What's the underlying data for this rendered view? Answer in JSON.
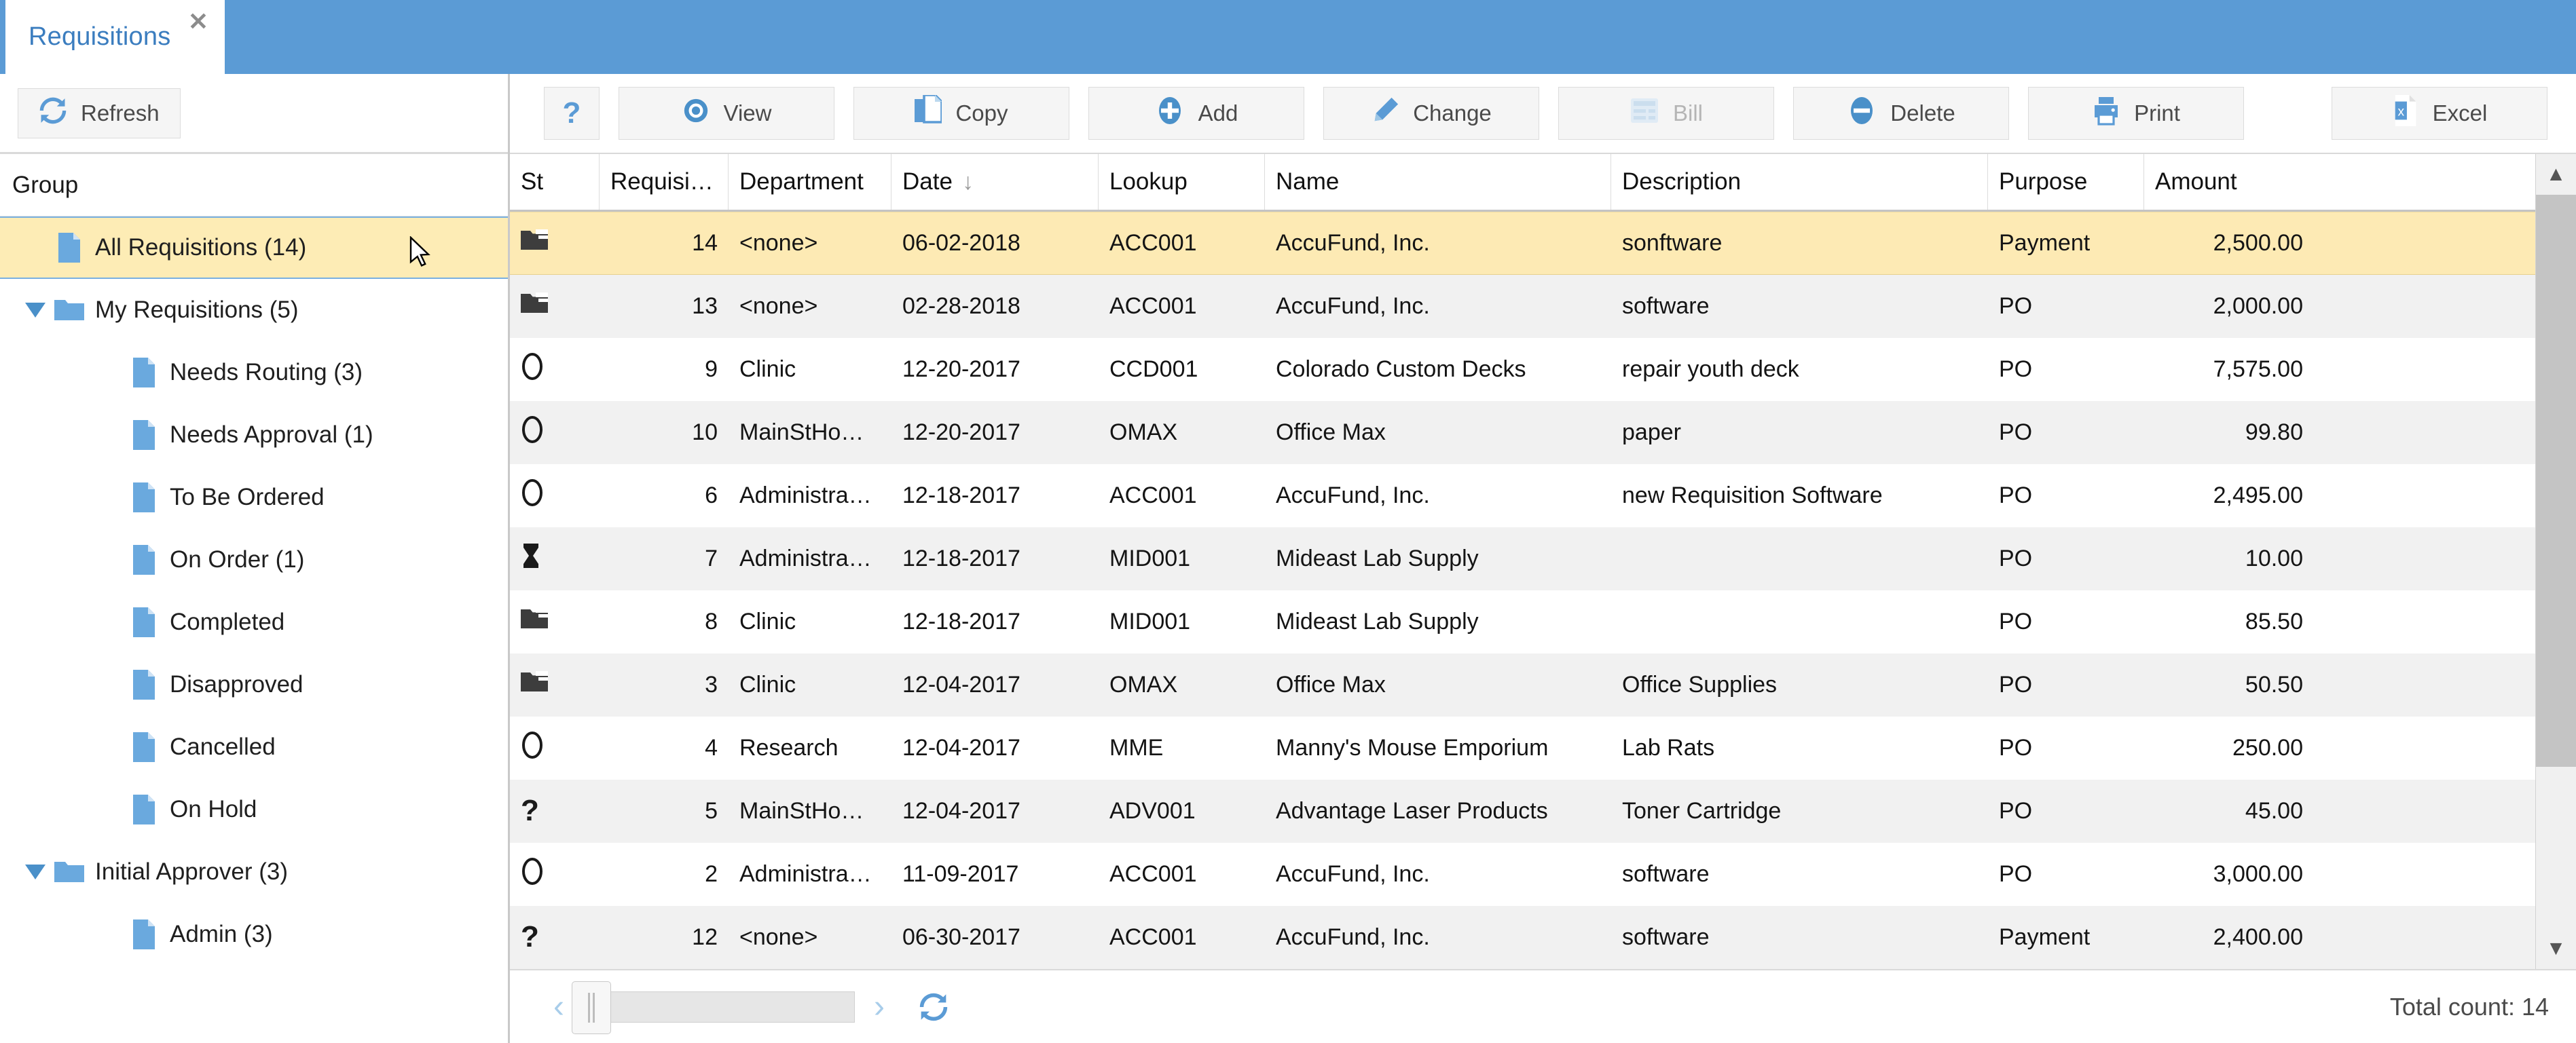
{
  "window": {
    "tab_title": "Requisitions",
    "close_label": "✕"
  },
  "left_panel": {
    "refresh_label": "Refresh",
    "group_header": "Group",
    "tree": [
      {
        "label": "All Requisitions (14)",
        "icon": "document-icon",
        "level": 0,
        "twisty": "",
        "selected": true
      },
      {
        "label": "My Requisitions (5)",
        "icon": "folder-open-icon",
        "level": 1,
        "twisty": "▼",
        "selected": false
      },
      {
        "label": "Needs Routing (3)",
        "icon": "document-icon",
        "level": 2,
        "twisty": "",
        "selected": false
      },
      {
        "label": "Needs Approval (1)",
        "icon": "document-icon",
        "level": 2,
        "twisty": "",
        "selected": false
      },
      {
        "label": "To Be Ordered",
        "icon": "document-icon",
        "level": 2,
        "twisty": "",
        "selected": false
      },
      {
        "label": "On Order (1)",
        "icon": "document-icon",
        "level": 2,
        "twisty": "",
        "selected": false
      },
      {
        "label": "Completed",
        "icon": "document-icon",
        "level": 2,
        "twisty": "",
        "selected": false
      },
      {
        "label": "Disapproved",
        "icon": "document-icon",
        "level": 2,
        "twisty": "",
        "selected": false
      },
      {
        "label": "Cancelled",
        "icon": "document-icon",
        "level": 2,
        "twisty": "",
        "selected": false
      },
      {
        "label": "On Hold",
        "icon": "document-icon",
        "level": 2,
        "twisty": "",
        "selected": false
      },
      {
        "label": "Initial Approver (3)",
        "icon": "folder-open-icon",
        "level": 1,
        "twisty": "▼",
        "selected": false
      },
      {
        "label": "Admin (3)",
        "icon": "document-icon",
        "level": 2,
        "twisty": "",
        "selected": false
      }
    ]
  },
  "toolbar": {
    "help_label": "?",
    "buttons": [
      {
        "label": "View",
        "icon": "eye-icon",
        "disabled": false
      },
      {
        "label": "Copy",
        "icon": "copy-icon",
        "disabled": false
      },
      {
        "label": "Add",
        "icon": "plus-circle-icon",
        "disabled": false
      },
      {
        "label": "Change",
        "icon": "pencil-icon",
        "disabled": false
      },
      {
        "label": "Bill",
        "icon": "invoice-icon",
        "disabled": true
      },
      {
        "label": "Delete",
        "icon": "minus-circle-icon",
        "disabled": false
      },
      {
        "label": "Print",
        "icon": "printer-icon",
        "disabled": false
      }
    ],
    "excel_label": "Excel",
    "excel_icon": "excel-icon"
  },
  "grid": {
    "columns": [
      {
        "key": "st",
        "label": "St",
        "sort": ""
      },
      {
        "key": "num",
        "label": "Requisi…",
        "sort": ""
      },
      {
        "key": "dept",
        "label": "Department",
        "sort": ""
      },
      {
        "key": "date",
        "label": "Date",
        "sort": "↓"
      },
      {
        "key": "lookup",
        "label": "Lookup",
        "sort": ""
      },
      {
        "key": "name",
        "label": "Name",
        "sort": ""
      },
      {
        "key": "desc",
        "label": "Description",
        "sort": ""
      },
      {
        "key": "purp",
        "label": "Purpose",
        "sort": ""
      },
      {
        "key": "amt",
        "label": "Amount",
        "sort": ""
      }
    ],
    "rows": [
      {
        "st": "folder-icon",
        "st_glyph": "📁",
        "num": "14",
        "dept": "<none>",
        "date": "06-02-2018",
        "lookup": "ACC001",
        "name": "AccuFund, Inc.",
        "desc": "sonftware",
        "purp": "Payment",
        "amt": "2,500.00",
        "selected": true
      },
      {
        "st": "folder-icon",
        "st_glyph": "📁",
        "num": "13",
        "dept": "<none>",
        "date": "02-28-2018",
        "lookup": "ACC001",
        "name": "AccuFund, Inc.",
        "desc": "software",
        "purp": "PO",
        "amt": "2,000.00",
        "selected": false
      },
      {
        "st": "circle-icon",
        "st_glyph": "◯",
        "num": "9",
        "dept": "Clinic",
        "date": "12-20-2017",
        "lookup": "CCD001",
        "name": "Colorado Custom Decks",
        "desc": "repair youth deck",
        "purp": "PO",
        "amt": "7,575.00",
        "selected": false
      },
      {
        "st": "circle-icon",
        "st_glyph": "◯",
        "num": "10",
        "dept": "MainStHo…",
        "date": "12-20-2017",
        "lookup": "OMAX",
        "name": "Office Max",
        "desc": "paper",
        "purp": "PO",
        "amt": "99.80",
        "selected": false
      },
      {
        "st": "circle-icon",
        "st_glyph": "◯",
        "num": "6",
        "dept": "Administra…",
        "date": "12-18-2017",
        "lookup": "ACC001",
        "name": "AccuFund, Inc.",
        "desc": "new Requisition Software",
        "purp": "PO",
        "amt": "2,495.00",
        "selected": false
      },
      {
        "st": "hourglass-icon",
        "st_glyph": "⌛",
        "num": "7",
        "dept": "Administra…",
        "date": "12-18-2017",
        "lookup": "MID001",
        "name": "Mideast Lab Supply",
        "desc": "",
        "purp": "PO",
        "amt": "10.00",
        "selected": false
      },
      {
        "st": "folder-icon",
        "st_glyph": "📁",
        "num": "8",
        "dept": "Clinic",
        "date": "12-18-2017",
        "lookup": "MID001",
        "name": "Mideast Lab Supply",
        "desc": "",
        "purp": "PO",
        "amt": "85.50",
        "selected": false
      },
      {
        "st": "folder-icon",
        "st_glyph": "📁",
        "num": "3",
        "dept": "Clinic",
        "date": "12-04-2017",
        "lookup": "OMAX",
        "name": "Office Max",
        "desc": "Office Supplies",
        "purp": "PO",
        "amt": "50.50",
        "selected": false
      },
      {
        "st": "circle-icon",
        "st_glyph": "◯",
        "num": "4",
        "dept": "Research",
        "date": "12-04-2017",
        "lookup": "MME",
        "name": "Manny's Mouse Emporium",
        "desc": "Lab Rats",
        "purp": "PO",
        "amt": "250.00",
        "selected": false
      },
      {
        "st": "question-icon",
        "st_glyph": "?",
        "num": "5",
        "dept": "MainStHo…",
        "date": "12-04-2017",
        "lookup": "ADV001",
        "name": "Advantage Laser Products",
        "desc": "Toner Cartridge",
        "purp": "PO",
        "amt": "45.00",
        "selected": false
      },
      {
        "st": "circle-icon",
        "st_glyph": "◯",
        "num": "2",
        "dept": "Administra…",
        "date": "11-09-2017",
        "lookup": "ACC001",
        "name": "AccuFund, Inc.",
        "desc": "software",
        "purp": "PO",
        "amt": "3,000.00",
        "selected": false
      },
      {
        "st": "question-icon",
        "st_glyph": "?",
        "num": "12",
        "dept": "<none>",
        "date": "06-30-2017",
        "lookup": "ACC001",
        "name": "AccuFund, Inc.",
        "desc": "software",
        "purp": "Payment",
        "amt": "2,400.00",
        "selected": false
      }
    ]
  },
  "statusbar": {
    "prev_label": "‹",
    "next_label": "›",
    "refresh_icon": "refresh-icon",
    "total_count": "Total count: 14"
  },
  "colors": {
    "accent": "#5b9bd5",
    "selection": "#fdecb5",
    "amount": "#1a9c20",
    "tab_text": "#3b7dbf"
  }
}
